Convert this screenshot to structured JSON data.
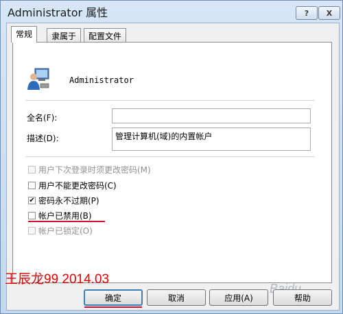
{
  "window": {
    "title": "Administrator 属性",
    "help_glyph": "?",
    "close_glyph": "X"
  },
  "tabs": [
    {
      "label": "常规",
      "active": true
    },
    {
      "label": "隶属于",
      "active": false
    },
    {
      "label": "配置文件",
      "active": false
    }
  ],
  "general": {
    "username": "Administrator",
    "fullname_label": "全名(F):",
    "fullname_value": "",
    "description_label": "描述(D):",
    "description_value": "管理计算机(域)的内置帐户",
    "checkboxes": [
      {
        "label": "用户下次登录时须更改密码(M)",
        "checked": false,
        "disabled": true
      },
      {
        "label": "用户不能更改密码(C)",
        "checked": false,
        "disabled": false
      },
      {
        "label": "密码永不过期(P)",
        "checked": true,
        "disabled": false
      },
      {
        "label": "帐户已禁用(B)",
        "checked": false,
        "disabled": false
      },
      {
        "label": "帐户已锁定(O)",
        "checked": false,
        "disabled": true
      }
    ],
    "check_glyph": "✔"
  },
  "buttons": {
    "ok": "确定",
    "cancel": "取消",
    "apply": "应用(A)",
    "help": "帮助"
  },
  "watermark": {
    "text": "王辰龙99 2014.03",
    "site": "Baidu"
  },
  "colors": {
    "annotation_red": "#d10f2c",
    "watermark_red": "#e00000",
    "frame_blue": "#c9dcef"
  }
}
